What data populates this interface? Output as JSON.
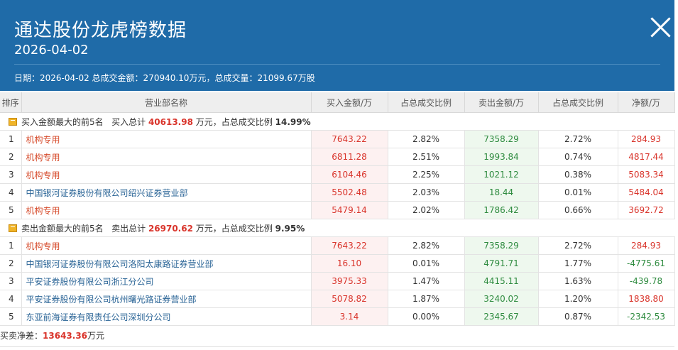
{
  "header": {
    "title": "通达股份龙虎榜数据",
    "date": "2026-04-02",
    "summary": "日期：2026-04-02 总成交金额：270940.10万元，总成交量：21099.67万股"
  },
  "table": {
    "columns": [
      "排序",
      "营业部名称",
      "买入金额/万",
      "占总成交比例",
      "卖出金额/万",
      "占总成交比例",
      "净额/万"
    ]
  },
  "buy_section": {
    "label": "买入金额最大的前5名",
    "total_prefix": "买入总计",
    "total": "40613.98",
    "unit_text": "万元，占总成交比例",
    "ratio": "14.99%",
    "rows": [
      {
        "idx": "1",
        "name": "机构专用",
        "buy": "7643.22",
        "buy_ratio": "2.82%",
        "sell": "7358.29",
        "sell_ratio": "2.72%",
        "net": "284.93"
      },
      {
        "idx": "2",
        "name": "机构专用",
        "buy": "6811.28",
        "buy_ratio": "2.51%",
        "sell": "1993.84",
        "sell_ratio": "0.74%",
        "net": "4817.44"
      },
      {
        "idx": "3",
        "name": "机构专用",
        "buy": "6104.46",
        "buy_ratio": "2.25%",
        "sell": "1021.12",
        "sell_ratio": "0.38%",
        "net": "5083.34"
      },
      {
        "idx": "4",
        "name": "中国银河证券股份有限公司绍兴证券营业部",
        "buy": "5502.48",
        "buy_ratio": "2.03%",
        "sell": "18.44",
        "sell_ratio": "0.01%",
        "net": "5484.04"
      },
      {
        "idx": "5",
        "name": "机构专用",
        "buy": "5479.14",
        "buy_ratio": "2.02%",
        "sell": "1786.42",
        "sell_ratio": "0.66%",
        "net": "3692.72"
      }
    ]
  },
  "sell_section": {
    "label": "卖出金额最大的前5名",
    "total_prefix": "卖出总计",
    "total": "26970.62",
    "unit_text": "万元，占总成交比例",
    "ratio": "9.95%",
    "rows": [
      {
        "idx": "1",
        "name": "机构专用",
        "buy": "7643.22",
        "buy_ratio": "2.82%",
        "sell": "7358.29",
        "sell_ratio": "2.72%",
        "net": "284.93"
      },
      {
        "idx": "2",
        "name": "中国银河证券股份有限公司洛阳太康路证券营业部",
        "buy": "16.10",
        "buy_ratio": "0.01%",
        "sell": "4791.71",
        "sell_ratio": "1.77%",
        "net": "-4775.61"
      },
      {
        "idx": "3",
        "name": "平安证券股份有限公司浙江分公司",
        "buy": "3975.33",
        "buy_ratio": "1.47%",
        "sell": "4415.11",
        "sell_ratio": "1.63%",
        "net": "-439.78"
      },
      {
        "idx": "4",
        "name": "平安证券股份有限公司杭州曙光路证券营业部",
        "buy": "5078.82",
        "buy_ratio": "1.87%",
        "sell": "3240.02",
        "sell_ratio": "1.20%",
        "net": "1838.80"
      },
      {
        "idx": "5",
        "name": "东亚前海证券有限责任公司深圳分公司",
        "buy": "3.14",
        "buy_ratio": "0.00%",
        "sell": "2345.67",
        "sell_ratio": "0.87%",
        "net": "-2342.53"
      }
    ]
  },
  "footer": {
    "label": "买卖净差：",
    "value": "13643.36",
    "unit": "万元"
  }
}
